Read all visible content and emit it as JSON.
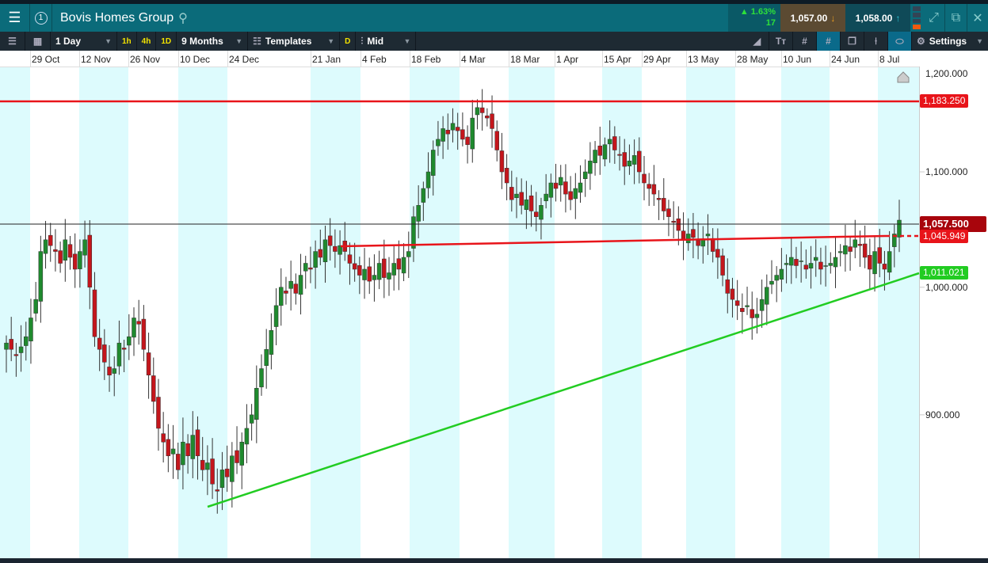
{
  "header": {
    "title": "Bovis Homes Group",
    "change_pct": "▲ 1.63%",
    "change_pts": "17",
    "sell": "1,057.00",
    "buy": "1,058.00",
    "window_number": "1"
  },
  "toolbar": {
    "interval": "1 Day",
    "q1h": "1h",
    "q4h": "4h",
    "q1d": "1D",
    "range": "9 Months",
    "templates": "Templates",
    "d": "D",
    "price_type": "Mid",
    "settings": "Settings"
  },
  "colors": {
    "up": "#1f8a2e",
    "down": "#c4161c",
    "band": "#ddfbfd",
    "resistance": "#e8141a",
    "support": "#22cc22"
  },
  "chart_data": {
    "type": "candlestick",
    "x_ticks": [
      "29 Oct",
      "12 Nov",
      "26 Nov",
      "10 Dec",
      "24 Dec",
      "21 Jan",
      "4 Feb",
      "18 Feb",
      "4 Mar",
      "18 Mar",
      "1 Apr",
      "15 Apr",
      "29 Apr",
      "13 May",
      "28 May",
      "10 Jun",
      "24 Jun",
      "8 Jul"
    ],
    "y_ticks": [
      "1,200.000",
      "1,100.000",
      "1,000.000",
      "900.000"
    ],
    "y_scale": "log",
    "ylim": [
      820,
      1210
    ],
    "closes": [
      955,
      950,
      945,
      952,
      960,
      975,
      990,
      1030,
      1040,
      1035,
      1030,
      1020,
      1040,
      1025,
      1015,
      1030,
      1040,
      1000,
      960,
      950,
      940,
      930,
      935,
      955,
      950,
      960,
      975,
      970,
      950,
      930,
      910,
      890,
      880,
      870,
      875,
      860,
      880,
      870,
      885,
      870,
      860,
      865,
      850,
      845,
      860,
      855,
      870,
      865,
      880,
      890,
      900,
      920,
      935,
      950,
      965,
      985,
      1000,
      995,
      1005,
      995,
      1010,
      1020,
      1015,
      1030,
      1025,
      1040,
      1035,
      1030,
      1035,
      1030,
      1020,
      1015,
      1010,
      1015,
      1005,
      1010,
      1020,
      1008,
      1012,
      1020,
      1015,
      1025,
      1030,
      1060,
      1070,
      1085,
      1100,
      1120,
      1130,
      1140,
      1135,
      1145,
      1138,
      1130,
      1125,
      1150,
      1160,
      1155,
      1150,
      1140,
      1120,
      1100,
      1090,
      1075,
      1080,
      1070,
      1075,
      1065,
      1060,
      1070,
      1080,
      1090,
      1085,
      1095,
      1080,
      1075,
      1085,
      1090,
      1100,
      1110,
      1120,
      1115,
      1125,
      1130,
      1120,
      1115,
      1105,
      1110,
      1115,
      1100,
      1090,
      1085,
      1080,
      1075,
      1065,
      1060,
      1055,
      1048,
      1040,
      1045,
      1042,
      1035,
      1040,
      1045,
      1030,
      1025,
      1010,
      995,
      990,
      985,
      980,
      985,
      975,
      978,
      990,
      1000,
      1005,
      1010,
      1015,
      1020,
      1025,
      1018,
      1022,
      1015,
      1020,
      1025,
      1015,
      1018,
      1020,
      1025,
      1030,
      1035,
      1030,
      1040,
      1035,
      1025,
      1015,
      1030,
      1020,
      1015,
      1030,
      1045,
      1057
    ],
    "lines": {
      "resistance": "1,183.250",
      "current": "1,057.500",
      "neckline": "1,045.949",
      "support": "1,011.021"
    }
  }
}
